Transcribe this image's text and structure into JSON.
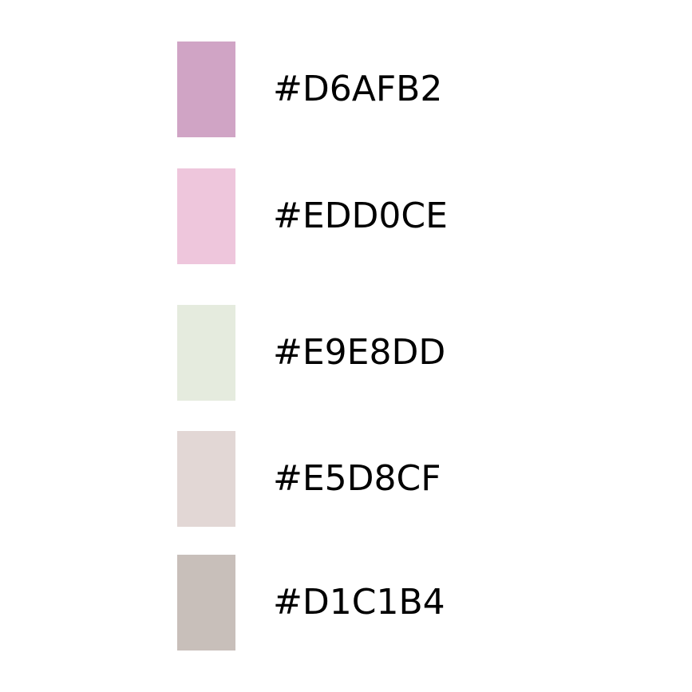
{
  "swatches": [
    {
      "label": "#D6AFB2",
      "color": "#D0A4C5"
    },
    {
      "label": "#EDD0CE",
      "color": "#EEC6DC"
    },
    {
      "label": "#E9E8DD",
      "color": "#E5EBDE"
    },
    {
      "label": "#E5D8CF",
      "color": "#E2D7D5"
    },
    {
      "label": "#D1C1B4",
      "color": "#C8BFBA"
    }
  ]
}
